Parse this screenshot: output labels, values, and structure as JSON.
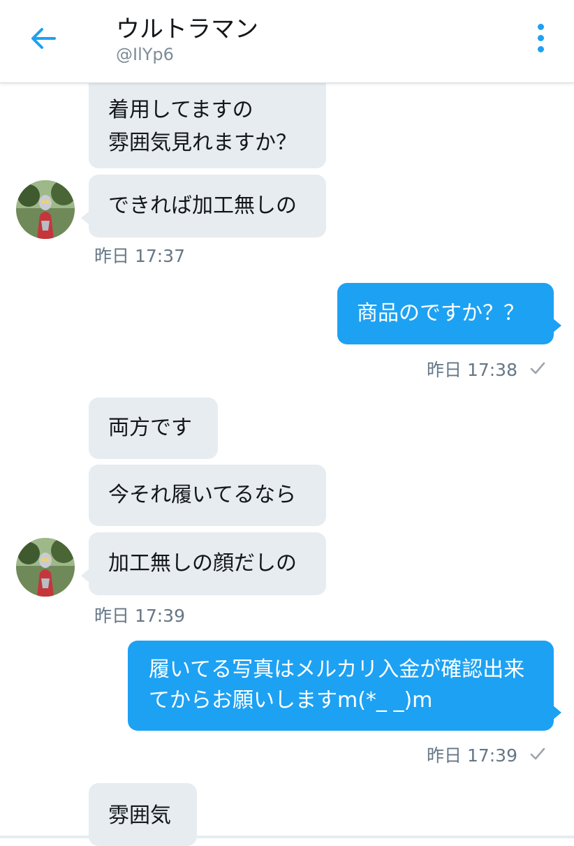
{
  "header": {
    "title": "ウルトラマン",
    "handle": "@IlYp6",
    "back_icon": "back-arrow-icon",
    "more_icon": "more-vertical-icon",
    "accent": "#1da1f2"
  },
  "messages": [
    {
      "direction": "in",
      "text": "着用してますの\n雰囲気見れますか？"
    },
    {
      "direction": "in",
      "text": "できれば加工無しの"
    },
    {
      "direction": "out",
      "text": "商品のですか？？"
    },
    {
      "direction": "in",
      "text": "両方です"
    },
    {
      "direction": "in",
      "text": "今それ履いてるなら"
    },
    {
      "direction": "in",
      "text": "加工無しの顔だしの"
    },
    {
      "direction": "out",
      "text": "履いてる写真はメルカリ入金が確認出来てからお願いしますm(*_ _)m"
    },
    {
      "direction": "in",
      "text": "雰囲気"
    }
  ],
  "timestamps": [
    {
      "label": "昨日 17:37"
    },
    {
      "label": "昨日 17:38",
      "read_receipt_icon": "checkmark-icon"
    },
    {
      "label": "昨日 17:39"
    },
    {
      "label": "昨日 17:39",
      "read_receipt_icon": "checkmark-icon"
    }
  ],
  "colors": {
    "incoming_bubble": "#e6ecf0",
    "outgoing_bubble": "#1da1f2",
    "timestamp_text": "#657786"
  }
}
